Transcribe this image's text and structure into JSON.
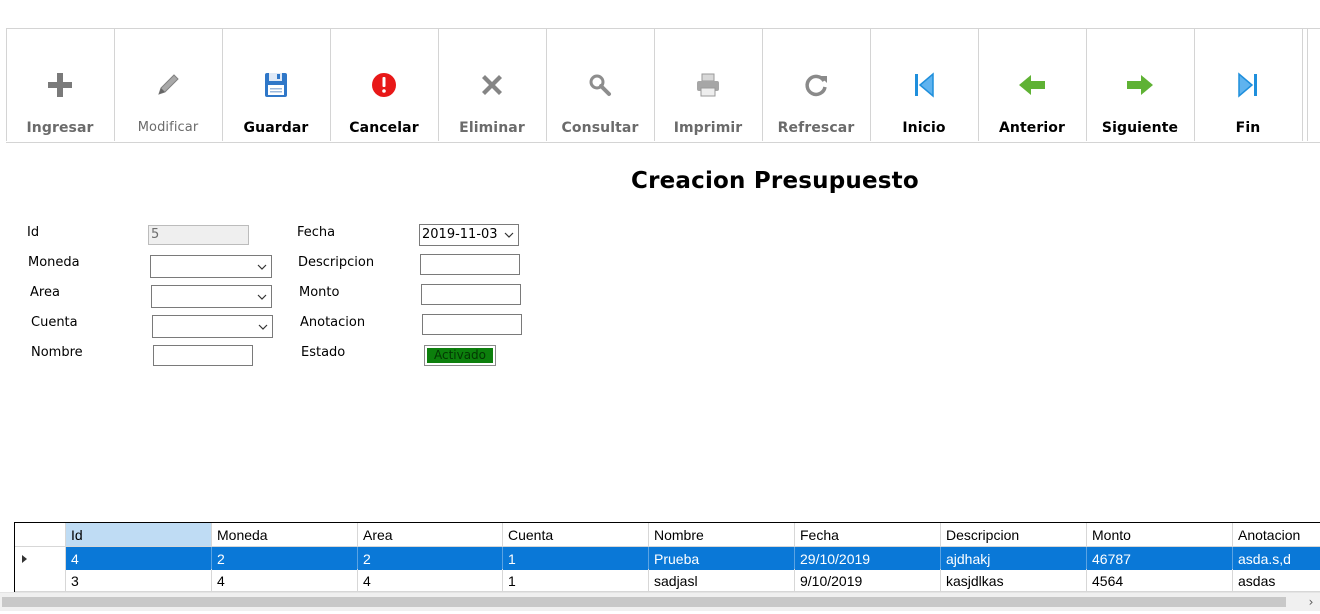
{
  "toolbar": {
    "buttons": [
      {
        "label": "Ingresar",
        "icon": "plus-icon"
      },
      {
        "label": "Modificar",
        "icon": "pencil-icon"
      },
      {
        "label": "Guardar",
        "icon": "floppy-disk-icon"
      },
      {
        "label": "Cancelar",
        "icon": "alert-icon"
      },
      {
        "label": "Eliminar",
        "icon": "x-icon"
      },
      {
        "label": "Consultar",
        "icon": "magnifier-icon"
      },
      {
        "label": "Imprimir",
        "icon": "printer-icon"
      },
      {
        "label": "Refrescar",
        "icon": "refresh-icon"
      },
      {
        "label": "Inicio",
        "icon": "first-record-icon"
      },
      {
        "label": "Anterior",
        "icon": "arrow-left-icon"
      },
      {
        "label": "Siguiente",
        "icon": "arrow-right-icon"
      },
      {
        "label": "Fin",
        "icon": "last-record-icon"
      }
    ]
  },
  "title": "Creacion Presupuesto",
  "form": {
    "id_label": "Id",
    "id_value": "5",
    "moneda_label": "Moneda",
    "area_label": "Area",
    "cuenta_label": "Cuenta",
    "nombre_label": "Nombre",
    "fecha_label": "Fecha",
    "fecha_value": "2019-11-03",
    "descripcion_label": "Descripcion",
    "monto_label": "Monto",
    "anotacion_label": "Anotacion",
    "estado_label": "Estado",
    "estado_value": "Activado"
  },
  "grid": {
    "columns": [
      "Id",
      "Moneda",
      "Area",
      "Cuenta",
      "Nombre",
      "Fecha",
      "Descripcion",
      "Monto",
      "Anotacion"
    ],
    "rows": [
      [
        "4",
        "2",
        "2",
        "1",
        "Prueba",
        "29/10/2019",
        "ajdhakj",
        "46787",
        "asda.s,d"
      ],
      [
        "3",
        "4",
        "4",
        "1",
        "sadjasl",
        "9/10/2019",
        "kasjdlkas",
        "4564",
        "asdas"
      ]
    ]
  },
  "colors": {
    "selection": "#0a78d7",
    "header_selected": "#bfdcf4",
    "estado_green": "#0c7f0c",
    "cancel_red": "#e81818",
    "nav_blue": "#1f8fdc",
    "arrow_green": "#5fb234"
  },
  "scrollbar": {
    "right_arrow": "›"
  }
}
